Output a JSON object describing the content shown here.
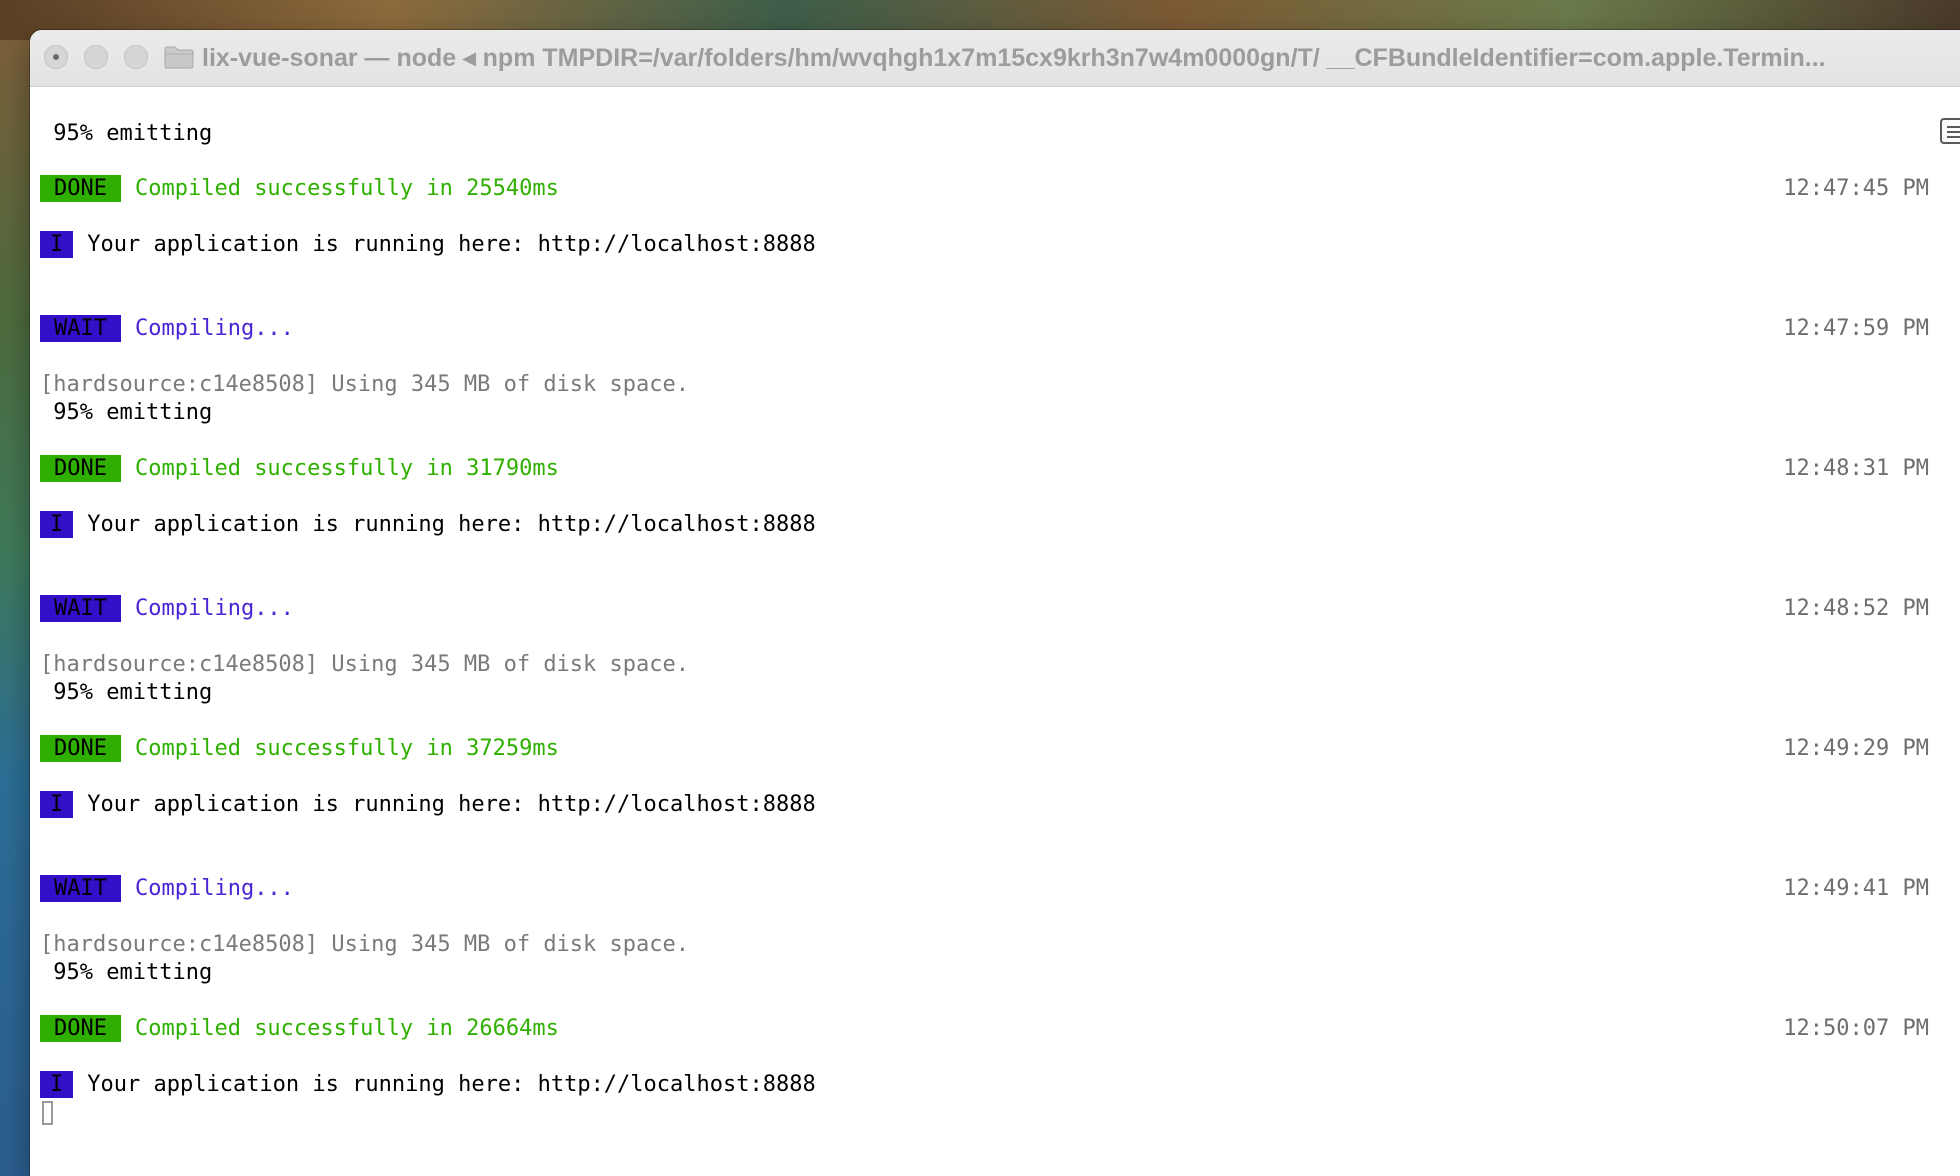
{
  "window": {
    "title": "lix-vue-sonar — node ◂ npm TMPDIR=/var/folders/hm/wvqhgh1x7m15cx9krh3n7w4m0000gn/T/ __CFBundleIdentifier=com.apple.Termin..."
  },
  "terminal": {
    "emit_0": "95% emitting",
    "done_1": {
      "badge": "DONE",
      "text": "Compiled successfully in 25540ms",
      "time": "12:47:45 PM"
    },
    "info_1": {
      "badge": "I",
      "text": "Your application is running here: http://localhost:8888"
    },
    "wait_2": {
      "badge": "WAIT",
      "text": "Compiling...",
      "time": "12:47:59 PM"
    },
    "hard_2": "[hardsource:c14e8508] Using 345 MB of disk space.",
    "emit_2": "95% emitting",
    "done_2": {
      "badge": "DONE",
      "text": "Compiled successfully in 31790ms",
      "time": "12:48:31 PM"
    },
    "info_2": {
      "badge": "I",
      "text": "Your application is running here: http://localhost:8888"
    },
    "wait_3": {
      "badge": "WAIT",
      "text": "Compiling...",
      "time": "12:48:52 PM"
    },
    "hard_3": "[hardsource:c14e8508] Using 345 MB of disk space.",
    "emit_3": "95% emitting",
    "done_3": {
      "badge": "DONE",
      "text": "Compiled successfully in 37259ms",
      "time": "12:49:29 PM"
    },
    "info_3": {
      "badge": "I",
      "text": "Your application is running here: http://localhost:8888"
    },
    "wait_4": {
      "badge": "WAIT",
      "text": "Compiling...",
      "time": "12:49:41 PM"
    },
    "hard_4": "[hardsource:c14e8508] Using 345 MB of disk space.",
    "emit_4": "95% emitting",
    "done_4": {
      "badge": "DONE",
      "text": "Compiled successfully in 26664ms",
      "time": "12:50:07 PM"
    },
    "info_4": {
      "badge": "I",
      "text": "Your application is running here: http://localhost:8888"
    }
  },
  "colors": {
    "done_badge": "#2fb000",
    "wait_badge": "#3310c8",
    "success_text": "#2fb000",
    "compiling_text": "#4b23d6"
  },
  "icons": [
    "folder-icon",
    "close-icon",
    "minimize-icon",
    "zoom-icon",
    "scroll-marker-icon"
  ]
}
